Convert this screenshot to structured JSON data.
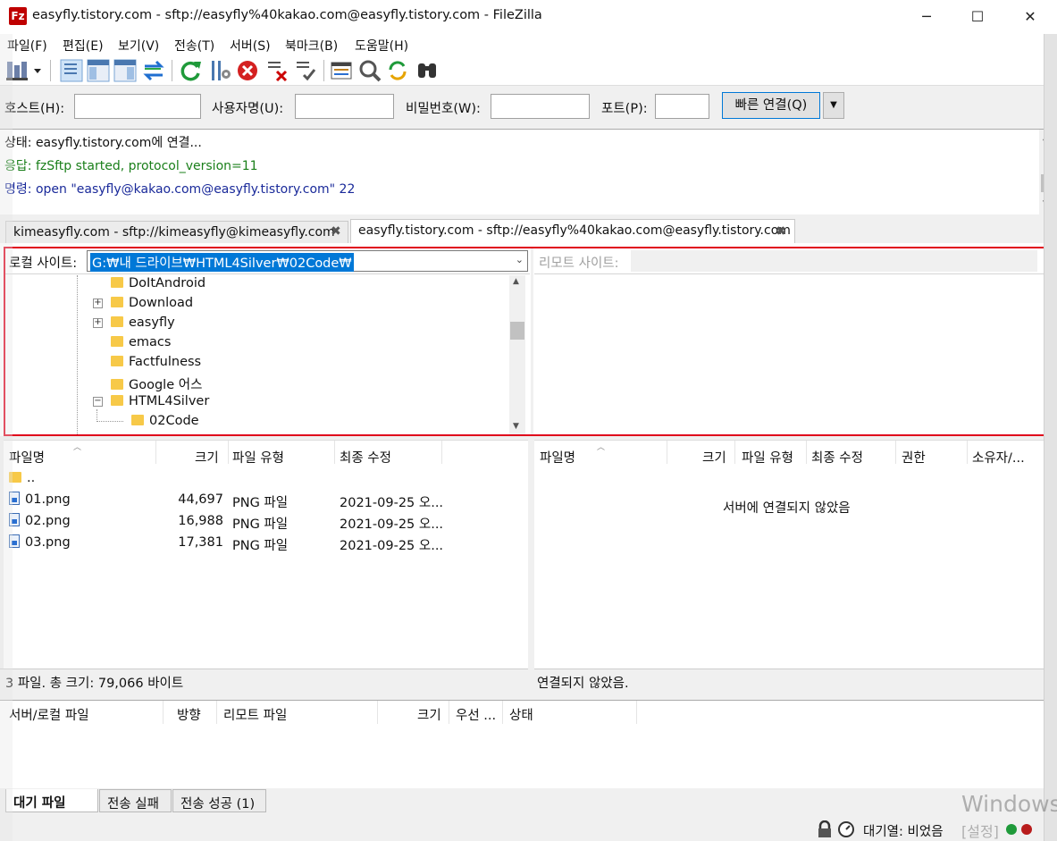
{
  "window": {
    "app_icon": "Fz",
    "title": "easyfly.tistory.com - sftp://easyfly%40kakao.com@easyfly.tistory.com - FileZilla",
    "controls": [
      "minimize-icon",
      "maximize-icon",
      "close-icon"
    ]
  },
  "menu": [
    "파일(F)",
    "편집(E)",
    "보기(V)",
    "전송(T)",
    "서버(S)",
    "북마크(B)",
    "도움말(H)"
  ],
  "toolbar": [
    "site-manager-icon",
    "toggle-log-icon",
    "toggle-local-tree-icon",
    "toggle-remote-tree-icon",
    "toggle-queue-icon",
    "refresh-icon",
    "process-queue-icon",
    "cancel-icon",
    "disconnect-icon",
    "reconnect-icon",
    "directory-listing-filter-icon",
    "toggle-comparison-icon",
    "sync-browsing-icon",
    "search-icon"
  ],
  "quickconnect": {
    "host_label": "호스트(H):",
    "user_label": "사용자명(U):",
    "pass_label": "비밀번호(W):",
    "port_label": "포트(P):",
    "host_value": "",
    "user_value": "",
    "pass_value": "",
    "port_value": "",
    "connect_label": "빠른 연결(Q)"
  },
  "log": [
    {
      "type": "상태:",
      "text": "easyfly.tistory.com에 연결...",
      "color": "#000000"
    },
    {
      "type": "응답:",
      "text": "fzSftp started, protocol_version=11",
      "color": "#1a7f1a"
    },
    {
      "type": "명령:",
      "text": "open \"easyfly@kakao.com@easyfly.tistory.com\" 22",
      "color": "#1a2a9a"
    }
  ],
  "tabs": [
    {
      "label": "kimeasyfly.com - sftp://kimeasyfly@kimeasyfly.com"
    },
    {
      "label": "easyfly.tistory.com - sftp://easyfly%40kakao.com@easyfly.tistory.com"
    }
  ],
  "local": {
    "site_label": "로컬 사이트:",
    "path": "G:₩내 드라이브₩HTML4Silver₩02Code₩",
    "tree": [
      {
        "name": "DoItAndroid",
        "expander": ""
      },
      {
        "name": "Download",
        "expander": "+"
      },
      {
        "name": "easyfly",
        "expander": "+"
      },
      {
        "name": "emacs",
        "expander": ""
      },
      {
        "name": "Factfulness",
        "expander": ""
      },
      {
        "name": "Google 어스",
        "expander": ""
      },
      {
        "name": "HTML4Silver",
        "expander": "−"
      },
      {
        "name": "02Code",
        "expander": ""
      }
    ],
    "columns": [
      "파일명",
      "크기",
      "파일 유형",
      "최종 수정"
    ],
    "files": [
      {
        "name": "..",
        "size": "",
        "type": "",
        "modified": ""
      },
      {
        "name": "01.png",
        "size": "44,697",
        "type": "PNG 파일",
        "modified": "2021-09-25 오..."
      },
      {
        "name": "02.png",
        "size": "16,988",
        "type": "PNG 파일",
        "modified": "2021-09-25 오..."
      },
      {
        "name": "03.png",
        "size": "17,381",
        "type": "PNG 파일",
        "modified": "2021-09-25 오..."
      }
    ],
    "status": "3 파일. 총 크기: 79,066 바이트"
  },
  "remote": {
    "site_label": "리모트 사이트:",
    "path": "",
    "columns": [
      "파일명",
      "크기",
      "파일 유형",
      "최종 수정",
      "권한",
      "소유자/..."
    ],
    "empty_message": "서버에 연결되지 않았음",
    "status": "연결되지 않았음."
  },
  "queue": {
    "columns": [
      "서버/로컬 파일",
      "방향",
      "리모트 파일",
      "크기",
      "우선 ...",
      "상태"
    ],
    "tabs": [
      "대기 파일",
      "전송 실패",
      "전송 성공 (1)"
    ]
  },
  "statusbar": {
    "queue_label": "대기열: 비었음"
  },
  "watermark": {
    "line1": "Windows",
    "line2": "[설정]"
  }
}
